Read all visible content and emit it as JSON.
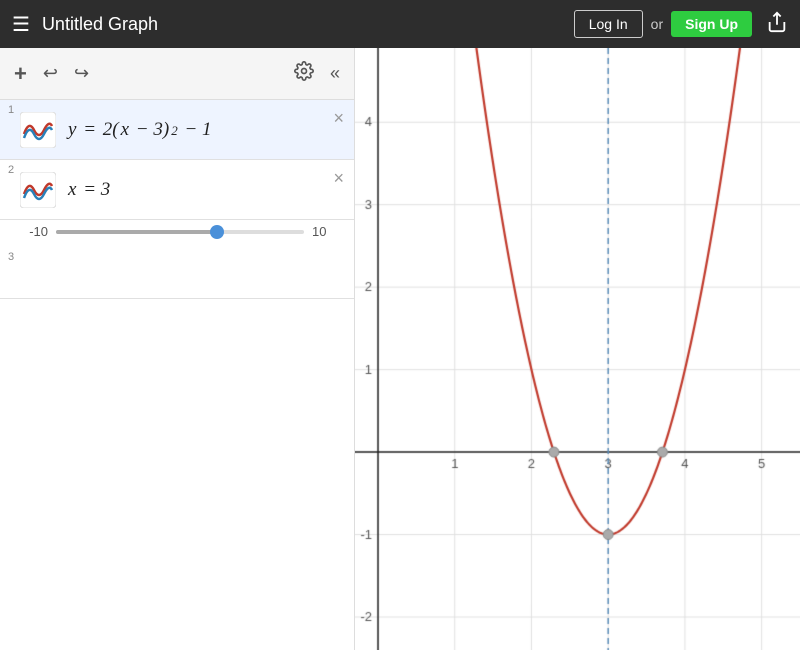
{
  "header": {
    "title": "Untitled Graph",
    "login_label": "Log In",
    "or_text": "or",
    "signup_label": "Sign Up"
  },
  "toolbar": {
    "add_label": "+",
    "undo_label": "↩",
    "redo_label": "↪"
  },
  "expressions": [
    {
      "id": 1,
      "number": "1",
      "formula_display": "y = 2(x − 3)² − 1",
      "active": true
    },
    {
      "id": 2,
      "number": "2",
      "formula_display": "x = 3",
      "has_slider": true,
      "slider_min": "-10",
      "slider_max": "10",
      "slider_value": 3
    },
    {
      "id": 3,
      "number": "3",
      "formula_display": ""
    }
  ],
  "graph": {
    "x_axis_labels": [
      "1",
      "2",
      "3",
      "4",
      "5"
    ],
    "y_axis_labels": [
      "4",
      "3",
      "2",
      "1",
      "-1",
      "-2"
    ],
    "parabola_color": "#c0392b",
    "vertical_line_color": "#5b8db8",
    "grid_color": "#e8e8e8",
    "axis_color": "#222"
  },
  "icons": {
    "hamburger": "☰",
    "settings": "⚙",
    "collapse": "«",
    "close": "×",
    "share": "⬆"
  }
}
